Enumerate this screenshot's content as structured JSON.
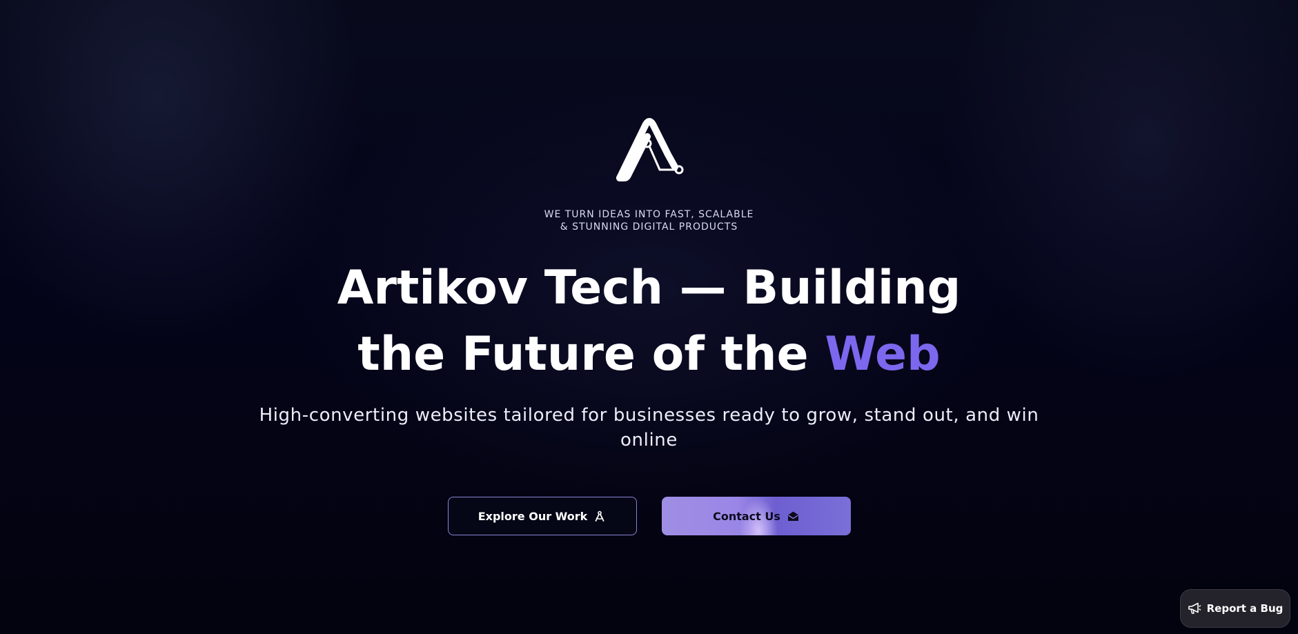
{
  "brand": {
    "logo_icon": "artikov-a-logo-icon"
  },
  "hero": {
    "tagline": "WE TURN IDEAS INTO FAST, SCALABLE & STUNNING DIGITAL PRODUCTS",
    "headline_main": "Artikov Tech — Building the Future of the",
    "headline_accent": "Web",
    "subtitle": "High-converting websites tailored for businesses ready to grow, stand out, and win online"
  },
  "actions": {
    "explore_label": "Explore Our Work",
    "explore_icon": "compass-drafting-icon",
    "contact_label": "Contact Us",
    "contact_icon": "envelope-open-icon"
  },
  "report_bug": {
    "label": "Report a Bug",
    "icon": "megaphone-icon"
  },
  "colors": {
    "background": "#03030f",
    "accent": "#7b68ee",
    "button_fill_start": "#9f8ee4",
    "button_fill_end": "#6d5fd0",
    "button_outline": "#8a83d6"
  }
}
